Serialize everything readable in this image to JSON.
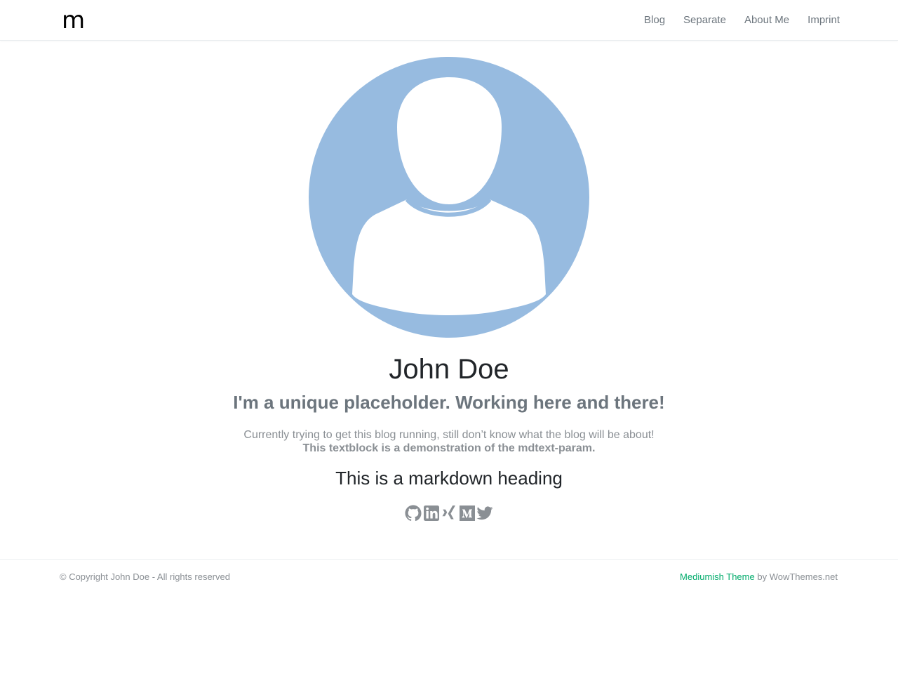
{
  "header": {
    "brand": "m",
    "nav": [
      {
        "label": "Blog"
      },
      {
        "label": "Separate"
      },
      {
        "label": "About Me"
      },
      {
        "label": "Imprint"
      }
    ]
  },
  "profile": {
    "avatar_icon": "person-silhouette-icon",
    "avatar_bg_color": "#97bbe0",
    "name": "John Doe",
    "tagline": "I'm a unique placeholder. Working here and there!",
    "description_line1": "Currently trying to get this blog running, still don’t know what the blog will be about!",
    "description_line2": "This textblock is a demonstration of the mdtext-param.",
    "markdown_heading": "This is a markdown heading",
    "socials": [
      {
        "icon": "github-icon"
      },
      {
        "icon": "linkedin-icon"
      },
      {
        "icon": "xing-icon"
      },
      {
        "icon": "medium-icon"
      },
      {
        "icon": "twitter-icon"
      }
    ]
  },
  "footer": {
    "copyright": "© Copyright John Doe - All rights reserved",
    "theme_link": "Mediumish Theme",
    "credit_suffix": " by WowThemes.net",
    "accent_color": "#00ab6b"
  }
}
